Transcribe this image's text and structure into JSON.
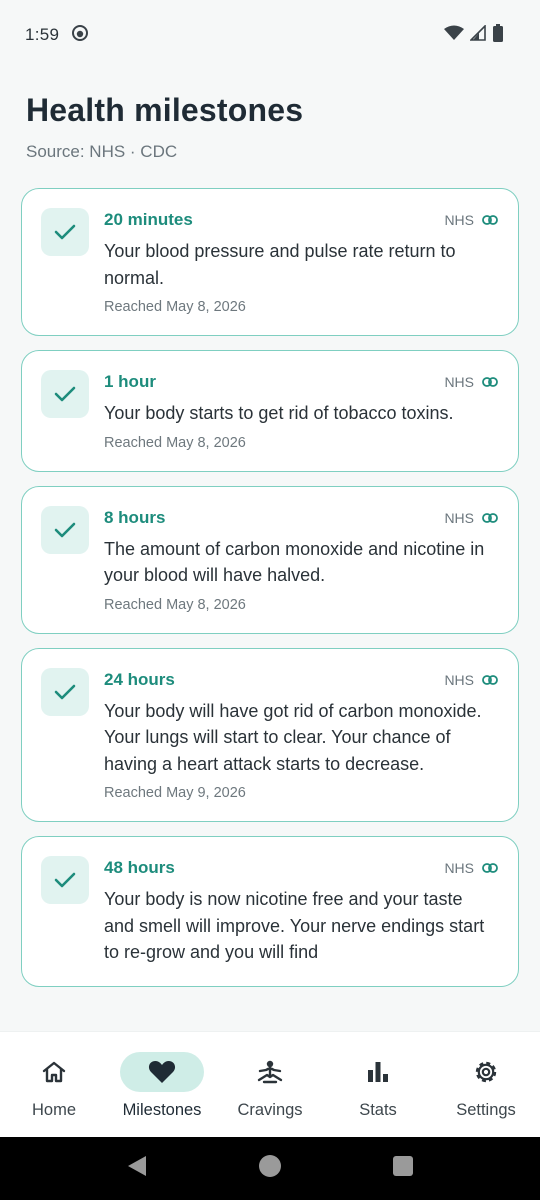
{
  "status_bar": {
    "time": "1:59"
  },
  "header": {
    "title": "Health milestones",
    "subtitle": "Source: NHS · CDC"
  },
  "milestones": [
    {
      "time": "20 minutes",
      "source": "NHS",
      "description": "Your blood pressure and pulse rate return to normal.",
      "reached": "Reached May 8, 2026"
    },
    {
      "time": "1 hour",
      "source": "NHS",
      "description": "Your body starts to get rid of tobacco toxins.",
      "reached": "Reached May 8, 2026"
    },
    {
      "time": "8 hours",
      "source": "NHS",
      "description": "The amount of carbon monoxide and nicotine in your blood will have halved.",
      "reached": "Reached May 8, 2026"
    },
    {
      "time": "24 hours",
      "source": "NHS",
      "description": "Your body will have got rid of carbon monoxide. Your lungs will start to clear. Your chance of having a heart attack starts to decrease.",
      "reached": "Reached May 9, 2026"
    },
    {
      "time": "48 hours",
      "source": "NHS",
      "description": "Your body is now nicotine free and your taste and smell will improve. Your nerve endings start to re-grow and you will find"
    }
  ],
  "bottom_nav": [
    {
      "label": "Home",
      "icon": "home-icon"
    },
    {
      "label": "Milestones",
      "icon": "heart-icon",
      "active": true
    },
    {
      "label": "Cravings",
      "icon": "meditation-icon"
    },
    {
      "label": "Stats",
      "icon": "bar-chart-icon"
    },
    {
      "label": "Settings",
      "icon": "gear-icon"
    }
  ],
  "colors": {
    "accent": "#1D8C7C",
    "card_border": "#7FCFC1",
    "check_bg": "#E1F3F0",
    "nav_active_bg": "#CFEDE7",
    "background": "#F6F8F8"
  }
}
